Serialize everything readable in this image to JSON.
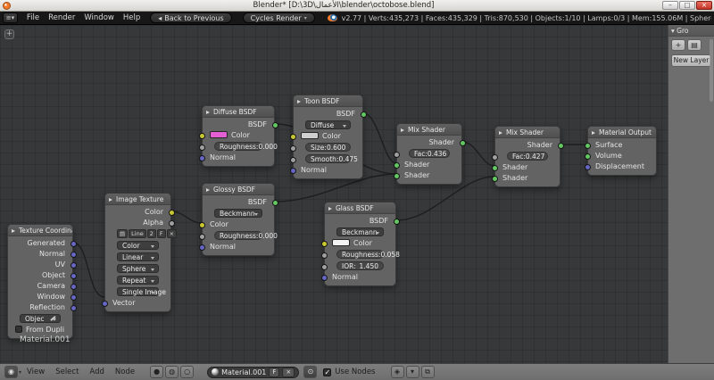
{
  "window": {
    "title": "Blender* [D:\\3D\\الأعمال\\blender\\octobose.blend]",
    "minimize": "–",
    "maximize": "□",
    "close": "×"
  },
  "topbar": {
    "menu_file": "File",
    "menu_render": "Render",
    "menu_window": "Window",
    "menu_help": "Help",
    "back_button": "Back to Previous",
    "engine_select": "Cycles Render",
    "stats": "v2.77 | Verts:435,273 | Faces:435,329 | Tris:870,530 | Objects:1/10 | Lamps:0/3 | Mem:155.06M | Sphere"
  },
  "right_panel": {
    "header": "Gro",
    "new_layer_button": "New Layer"
  },
  "canvas": {
    "material_label": "Material.001"
  },
  "colors": {
    "socket_shader": "#63c763",
    "socket_color": "#c8c832",
    "socket_value": "#a1a1a1",
    "socket_vector": "#6666c4",
    "diffuse_color_swatch": "#e45fd3",
    "toon_color_swatch": "#cfcfcf",
    "glass_color_swatch": "#f4f4f4",
    "wire": "#1c1c1c"
  },
  "nodes": {
    "texture_coordinate": {
      "title": "Texture Coordinate",
      "out_generated": "Generated",
      "out_normal": "Normal",
      "out_uv": "UV",
      "out_object": "Object",
      "out_camera": "Camera",
      "out_window": "Window",
      "out_reflection": "Reflection",
      "object_field": "Objec",
      "from_dupli": "From Dupli"
    },
    "image_texture": {
      "title": "Image Texture",
      "out_color": "Color",
      "out_alpha": "Alpha",
      "image_name": "Line",
      "users_count": "2",
      "fake_user": "F",
      "color_space": "Color",
      "interpolation": "Linear",
      "projection": "Sphere",
      "extension": "Repeat",
      "source": "Single Image",
      "in_vector": "Vector"
    },
    "diffuse_bsdf": {
      "title": "Diffuse BSDF",
      "out_bsdf": "BSDF",
      "color_label": "Color",
      "roughness_label": "Roughness:",
      "roughness_value": "0.000",
      "in_normal": "Normal"
    },
    "toon_bsdf": {
      "title": "Toon BSDF",
      "out_bsdf": "BSDF",
      "component": "Diffuse",
      "color_label": "Color",
      "size_label": "Size:",
      "size_value": "0.600",
      "smooth_label": "Smooth:",
      "smooth_value": "0.475",
      "in_normal": "Normal"
    },
    "glossy_bsdf": {
      "title": "Glossy BSDF",
      "out_bsdf": "BSDF",
      "distribution": "Beckmann",
      "color_label": "Color",
      "roughness_label": "Roughness:",
      "roughness_value": "0.000",
      "in_normal": "Normal"
    },
    "glass_bsdf": {
      "title": "Glass BSDF",
      "out_bsdf": "BSDF",
      "distribution": "Beckmann",
      "color_label": "Color",
      "roughness_label": "Roughness:",
      "roughness_value": "0.058",
      "ior_label": "IOR:",
      "ior_value": "1.450",
      "in_normal": "Normal"
    },
    "mix_shader_1": {
      "title": "Mix Shader",
      "out_shader": "Shader",
      "fac_label": "Fac:",
      "fac_value": "0.436",
      "in_shader_1": "Shader",
      "in_shader_2": "Shader"
    },
    "mix_shader_2": {
      "title": "Mix Shader",
      "out_shader": "Shader",
      "fac_label": "Fac:",
      "fac_value": "0.427",
      "in_shader_1": "Shader",
      "in_shader_2": "Shader"
    },
    "material_output": {
      "title": "Material Output",
      "in_surface": "Surface",
      "in_volume": "Volume",
      "in_displacement": "Displacement"
    }
  },
  "links": [
    {
      "from": "Texture Coordinate.Generated",
      "to": "Image Texture.Vector"
    },
    {
      "from": "Image Texture.Color",
      "to": "Glossy BSDF.Color"
    },
    {
      "from": "Diffuse BSDF.BSDF",
      "to": "Mix Shader 1.Shader 2"
    },
    {
      "from": "Toon BSDF.BSDF",
      "to": "Mix Shader 1.Shader 1"
    },
    {
      "from": "Glossy BSDF.BSDF",
      "to": "Mix Shader 1.Shader 2"
    },
    {
      "from": "Mix Shader 1.Shader",
      "to": "Mix Shader 2.Shader 1"
    },
    {
      "from": "Glass BSDF.BSDF",
      "to": "Mix Shader 2.Shader 2"
    },
    {
      "from": "Mix Shader 2.Shader",
      "to": "Material Output.Surface"
    }
  ],
  "footer": {
    "menu_view": "View",
    "menu_select": "Select",
    "menu_add": "Add",
    "menu_node": "Node",
    "material_name": "Material.001",
    "fake_user": "F",
    "use_nodes_label": "Use Nodes"
  }
}
